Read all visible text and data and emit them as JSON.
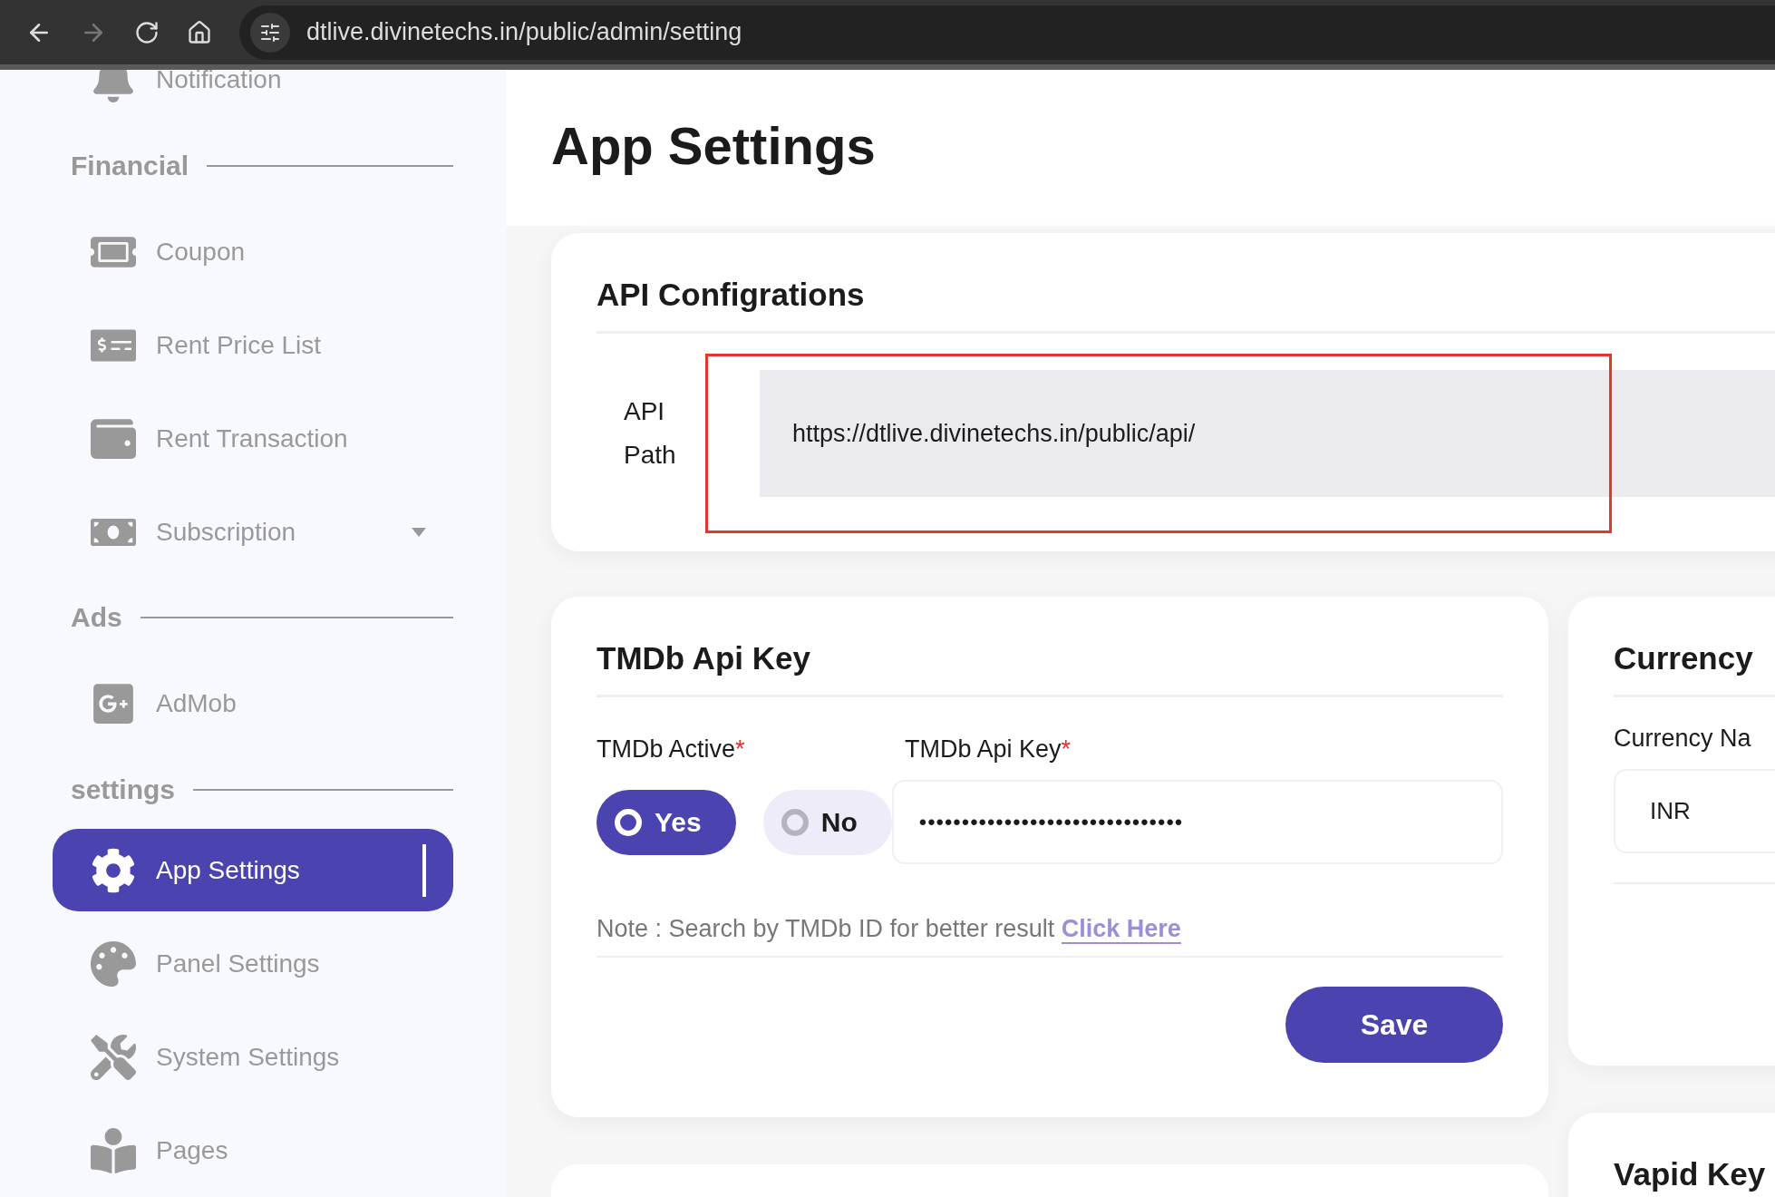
{
  "browser": {
    "url": "dtlive.divinetechs.in/public/admin/setting"
  },
  "sidebar": {
    "groups": [
      {
        "items": [
          {
            "label": "Notification",
            "selected": false
          }
        ]
      },
      {
        "heading": "Financial",
        "items": [
          {
            "label": "Coupon",
            "selected": false
          },
          {
            "label": "Rent Price List",
            "selected": false
          },
          {
            "label": "Rent Transaction",
            "selected": false
          },
          {
            "label": "Subscription",
            "selected": false,
            "expandable": true
          }
        ]
      },
      {
        "heading": "Ads",
        "items": [
          {
            "label": "AdMob",
            "selected": false
          }
        ]
      },
      {
        "heading": "settings",
        "items": [
          {
            "label": "App Settings",
            "selected": true
          },
          {
            "label": "Panel Settings",
            "selected": false
          },
          {
            "label": "System Settings",
            "selected": false
          },
          {
            "label": "Pages",
            "selected": false
          }
        ]
      }
    ]
  },
  "page_title": "App Settings",
  "api_card": {
    "title": "API Configrations",
    "field_label": "API Path",
    "value": "https://dtlive.divinetechs.in/public/api/",
    "highlighted": true
  },
  "tmdb_card": {
    "title": "TMDb Api Key",
    "active_label": "TMDb Active",
    "active_required_mark": "*",
    "options": [
      {
        "label": "Yes",
        "selected": true
      },
      {
        "label": "No",
        "selected": false
      }
    ],
    "key_label": "TMDb Api Key",
    "key_required_mark": "*",
    "key_value": "•••••••••••••••••••••••••••••••",
    "note": "Note : Search by TMDb ID for better result",
    "link": "Click Here",
    "save": "Save"
  },
  "currency_card": {
    "title": "Currency",
    "field_label": "Currency Na",
    "value": "INR"
  },
  "vapid_card": {
    "title": "Vapid Key"
  }
}
